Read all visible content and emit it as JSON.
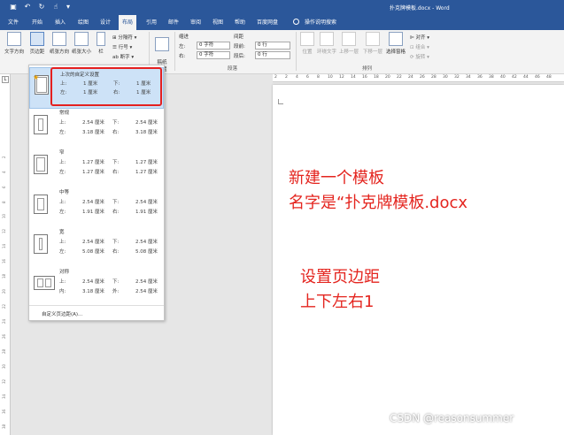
{
  "titlebar": {
    "document_title": "扑克牌模板.docx - Word",
    "quick_access": [
      "save-icon",
      "undo-icon",
      "redo-icon",
      "touch-mode-icon",
      "customize-icon"
    ]
  },
  "tabs": [
    "文件",
    "开始",
    "插入",
    "绘图",
    "设计",
    "布局",
    "引用",
    "邮件",
    "审阅",
    "视图",
    "帮助",
    "百度网盘"
  ],
  "active_tab": "布局",
  "tell_me": "操作说明搜索",
  "ribbon": {
    "text_direction": "文字方向",
    "margins": "页边距",
    "orientation": "纸张方向",
    "size": "纸张大小",
    "columns": "栏",
    "breaks": "分隔符",
    "line_numbers": "行号",
    "hyphenation": "断字",
    "manuscript": "稿纸\n设置",
    "indent_label": "缩进",
    "left_label": "左:",
    "left_value": "0 字符",
    "right_label": "右:",
    "right_value": "0 字符",
    "spacing_label": "间距",
    "before_label": "段前:",
    "before_value": "0 行",
    "after_label": "段后:",
    "after_value": "0 行",
    "paragraph_group": "段落",
    "position": "位置",
    "wrap_text": "环绕文字",
    "bring_forward": "上移一层",
    "send_backward": "下移一层",
    "selection_pane": "选择窗格",
    "align": "对齐",
    "group": "组合",
    "rotate": "旋转",
    "arrange_group": "排列"
  },
  "margins_dropdown": {
    "options": [
      {
        "name": "上次的自定义设置",
        "k1": "上:",
        "v1": "1 厘米",
        "k2": "下:",
        "v2": "1 厘米",
        "k3": "左:",
        "v3": "1 厘米",
        "k4": "右:",
        "v4": "1 厘米"
      },
      {
        "name": "常规",
        "k1": "上:",
        "v1": "2.54 厘米",
        "k2": "下:",
        "v2": "2.54 厘米",
        "k3": "左:",
        "v3": "3.18 厘米",
        "k4": "右:",
        "v4": "3.18 厘米"
      },
      {
        "name": "窄",
        "k1": "上:",
        "v1": "1.27 厘米",
        "k2": "下:",
        "v2": "1.27 厘米",
        "k3": "左:",
        "v3": "1.27 厘米",
        "k4": "右:",
        "v4": "1.27 厘米"
      },
      {
        "name": "中等",
        "k1": "上:",
        "v1": "2.54 厘米",
        "k2": "下:",
        "v2": "2.54 厘米",
        "k3": "左:",
        "v3": "1.91 厘米",
        "k4": "右:",
        "v4": "1.91 厘米"
      },
      {
        "name": "宽",
        "k1": "上:",
        "v1": "2.54 厘米",
        "k2": "下:",
        "v2": "2.54 厘米",
        "k3": "左:",
        "v3": "5.08 厘米",
        "k4": "右:",
        "v4": "5.08 厘米"
      },
      {
        "name": "对称",
        "k1": "上:",
        "v1": "2.54 厘米",
        "k2": "下:",
        "v2": "2.54 厘米",
        "k3": "内:",
        "v3": "3.18 厘米",
        "k4": "外:",
        "v4": "2.54 厘米"
      }
    ],
    "custom": "自定义页边距(A)..."
  },
  "ruler": {
    "h_ticks": [
      "2",
      "2",
      "4",
      "6",
      "8",
      "10",
      "12",
      "14",
      "16",
      "18",
      "20",
      "22",
      "24",
      "26",
      "28",
      "30",
      "32",
      "34",
      "36",
      "38",
      "40",
      "42",
      "44",
      "46",
      "48"
    ],
    "v_ticks": [
      "2",
      "4",
      "6",
      "8",
      "10",
      "12",
      "14",
      "16",
      "18",
      "20",
      "22",
      "24",
      "26",
      "28",
      "30",
      "32",
      "34",
      "36",
      "38",
      "40",
      "42",
      "44"
    ]
  },
  "annotations": {
    "line1": "新建一个模板",
    "line2": "名字是“扑克牌模板.docx",
    "line3": "设置页边距",
    "line4": "上下左右1"
  },
  "watermark": "CSDN @reasonsummer",
  "colors": {
    "title_bar": "#2b579a",
    "annotation": "#e4251f",
    "selected_option": "#cde2f7"
  }
}
